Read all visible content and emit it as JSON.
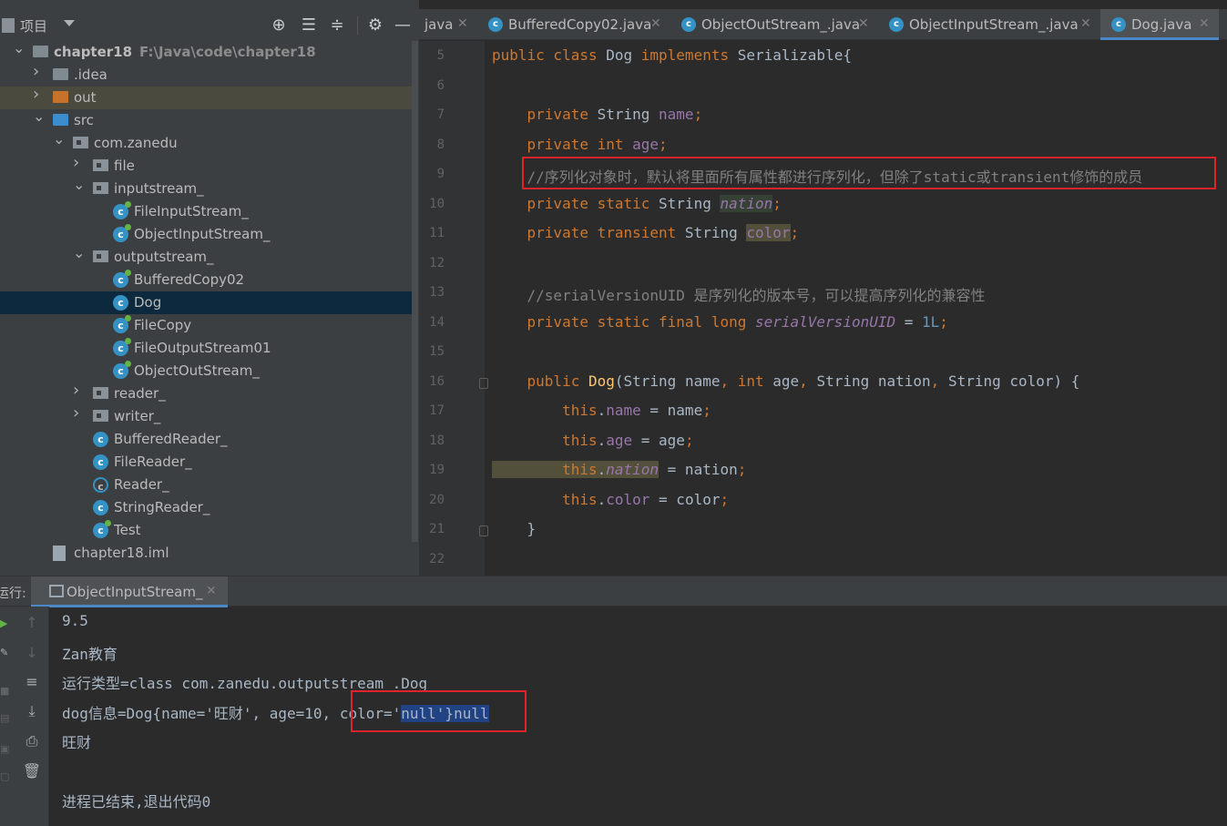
{
  "project": {
    "title": "项目",
    "tree": [
      {
        "label": "chapter18",
        "path": "F:\\Java\\code\\chapter18",
        "type": "module",
        "arrow": "down",
        "depth": 0
      },
      {
        "label": ".idea",
        "type": "folder",
        "arrow": "right",
        "depth": 1
      },
      {
        "label": "out",
        "type": "folder-orange",
        "arrow": "right",
        "depth": 1,
        "excluded": true
      },
      {
        "label": "src",
        "type": "folder-blue",
        "arrow": "down",
        "depth": 1
      },
      {
        "label": "com.zanedu",
        "type": "package",
        "arrow": "down",
        "depth": 2
      },
      {
        "label": "file",
        "type": "package",
        "arrow": "right",
        "depth": 3
      },
      {
        "label": "inputstream_",
        "type": "package",
        "arrow": "down",
        "depth": 3
      },
      {
        "label": "FileInputStream_",
        "type": "class-run",
        "depth": 4
      },
      {
        "label": "ObjectInputStream_",
        "type": "class-run",
        "depth": 4
      },
      {
        "label": "outputstream_",
        "type": "package",
        "arrow": "down",
        "depth": 3
      },
      {
        "label": "BufferedCopy02",
        "type": "class-run",
        "depth": 4
      },
      {
        "label": "Dog",
        "type": "class",
        "depth": 4,
        "selected": true
      },
      {
        "label": "FileCopy",
        "type": "class-run",
        "depth": 4
      },
      {
        "label": "FileOutputStream01",
        "type": "class-run",
        "depth": 4
      },
      {
        "label": "ObjectOutStream_",
        "type": "class-run",
        "depth": 4
      },
      {
        "label": "reader_",
        "type": "package",
        "arrow": "right",
        "depth": 3
      },
      {
        "label": "writer_",
        "type": "package",
        "arrow": "right",
        "depth": 3
      },
      {
        "label": "BufferedReader_",
        "type": "class",
        "depth": 3
      },
      {
        "label": "FileReader_",
        "type": "class",
        "depth": 3
      },
      {
        "label": "Reader_",
        "type": "class-abstract",
        "depth": 3
      },
      {
        "label": "StringReader_",
        "type": "class",
        "depth": 3
      },
      {
        "label": "Test",
        "type": "class-run",
        "depth": 3
      },
      {
        "label": "chapter18.iml",
        "type": "iml",
        "depth": 1
      }
    ]
  },
  "editor": {
    "tabs": [
      {
        "label": "java",
        "icon": false,
        "active": false
      },
      {
        "label": "BufferedCopy02.java",
        "icon": true,
        "active": false
      },
      {
        "label": "ObjectOutStream_.java",
        "icon": true,
        "active": false
      },
      {
        "label": "ObjectInputStream_.java",
        "icon": true,
        "active": false
      },
      {
        "label": "Dog.java",
        "icon": true,
        "active": true
      }
    ],
    "line_numbers": [
      "5",
      "6",
      "7",
      "8",
      "9",
      "10",
      "11",
      "12",
      "13",
      "14",
      "15",
      "16",
      "17",
      "18",
      "19",
      "20",
      "21",
      "22"
    ],
    "code_tokens": [
      [
        [
          "public class ",
          "kw"
        ],
        [
          "Dog ",
          ""
        ],
        [
          "implements ",
          "kw"
        ],
        [
          "Serializable{",
          ""
        ]
      ],
      [],
      [
        [
          "    private ",
          "kw"
        ],
        [
          "String ",
          ""
        ],
        [
          "name",
          "fld"
        ],
        [
          ";",
          "kw"
        ]
      ],
      [
        [
          "    private int ",
          "kw"
        ],
        [
          "age",
          "fld"
        ],
        [
          ";",
          "kw"
        ]
      ],
      [
        [
          "    //序列化对象时，默认将里面所有属性都进行序列化，但除了static或transient修饰的成员",
          "cmt"
        ]
      ],
      [
        [
          "    private static ",
          "kw"
        ],
        [
          "String ",
          ""
        ],
        [
          "nation",
          "sfld hl-nation"
        ],
        [
          ";",
          "kw"
        ]
      ],
      [
        [
          "    private transient ",
          "kw"
        ],
        [
          "String ",
          ""
        ],
        [
          "color",
          "fld hl-color"
        ],
        [
          ";",
          "kw"
        ]
      ],
      [],
      [
        [
          "    //serialVersionUID 是序列化的版本号，可以提高序列化的兼容性",
          "cmt"
        ]
      ],
      [
        [
          "    private static final long ",
          "kw"
        ],
        [
          "serialVersionUID",
          "sfld"
        ],
        [
          " = ",
          ""
        ],
        [
          "1L",
          "num"
        ],
        [
          ";",
          "kw"
        ]
      ],
      [],
      [
        [
          "    public ",
          "kw"
        ],
        [
          "Dog",
          "mth"
        ],
        [
          "(String name",
          ""
        ],
        [
          ", ",
          "kw"
        ],
        [
          "int ",
          "kw"
        ],
        [
          "age",
          ""
        ],
        [
          ", ",
          "kw"
        ],
        [
          "String nation",
          ""
        ],
        [
          ", ",
          "kw"
        ],
        [
          "String color) {",
          ""
        ]
      ],
      [
        [
          "        this",
          "kw"
        ],
        [
          ".",
          ""
        ],
        [
          "name",
          "fld"
        ],
        [
          " = name",
          ""
        ],
        [
          ";",
          "kw"
        ]
      ],
      [
        [
          "        this",
          "kw"
        ],
        [
          ".",
          ""
        ],
        [
          "age",
          "fld"
        ],
        [
          " = age",
          ""
        ],
        [
          ";",
          "kw"
        ]
      ],
      [
        [
          "        this",
          "kw hl-this"
        ],
        [
          ".",
          "hl-this"
        ],
        [
          "nation",
          "sfld hl-this"
        ],
        [
          " = nation",
          ""
        ],
        [
          ";",
          "kw"
        ]
      ],
      [
        [
          "        this",
          "kw"
        ],
        [
          ".",
          ""
        ],
        [
          "color",
          "fld"
        ],
        [
          " = color",
          ""
        ],
        [
          ";",
          "kw"
        ]
      ],
      [
        [
          "    }",
          ""
        ]
      ],
      []
    ]
  },
  "run": {
    "label": "运行:",
    "tab_label": "ObjectInputStream_",
    "output": [
      [
        [
          "9.5",
          ""
        ]
      ],
      [
        [
          "Zan教育",
          ""
        ]
      ],
      [
        [
          "运行类型=class com.zanedu.outputstream_.Dog",
          ""
        ]
      ],
      [
        [
          "dog信息=Dog{name='旺财', age=10, color='",
          ""
        ],
        [
          "null'}null",
          "sel"
        ]
      ],
      [
        [
          "旺财",
          ""
        ]
      ],
      [],
      [
        [
          "进程已结束,退出代码0",
          ""
        ]
      ]
    ]
  },
  "colors": {
    "background": "#2b2b2b",
    "panel": "#3c3f41",
    "keyword": "#cc7832",
    "field": "#9876aa",
    "comment": "#808080",
    "number": "#6897bb",
    "method": "#ffc66d",
    "selection": "#214283",
    "annotation_box": "#e0222a"
  },
  "icons": [
    "project-icon",
    "dropdown-icon",
    "locate-icon",
    "expand-all-icon",
    "collapse-all-icon",
    "gear-icon",
    "minimize-icon",
    "rerun-icon",
    "up-arrow-icon",
    "down-arrow-icon",
    "soft-wrap-icon",
    "scroll-to-end-icon",
    "print-icon",
    "trash-icon"
  ]
}
